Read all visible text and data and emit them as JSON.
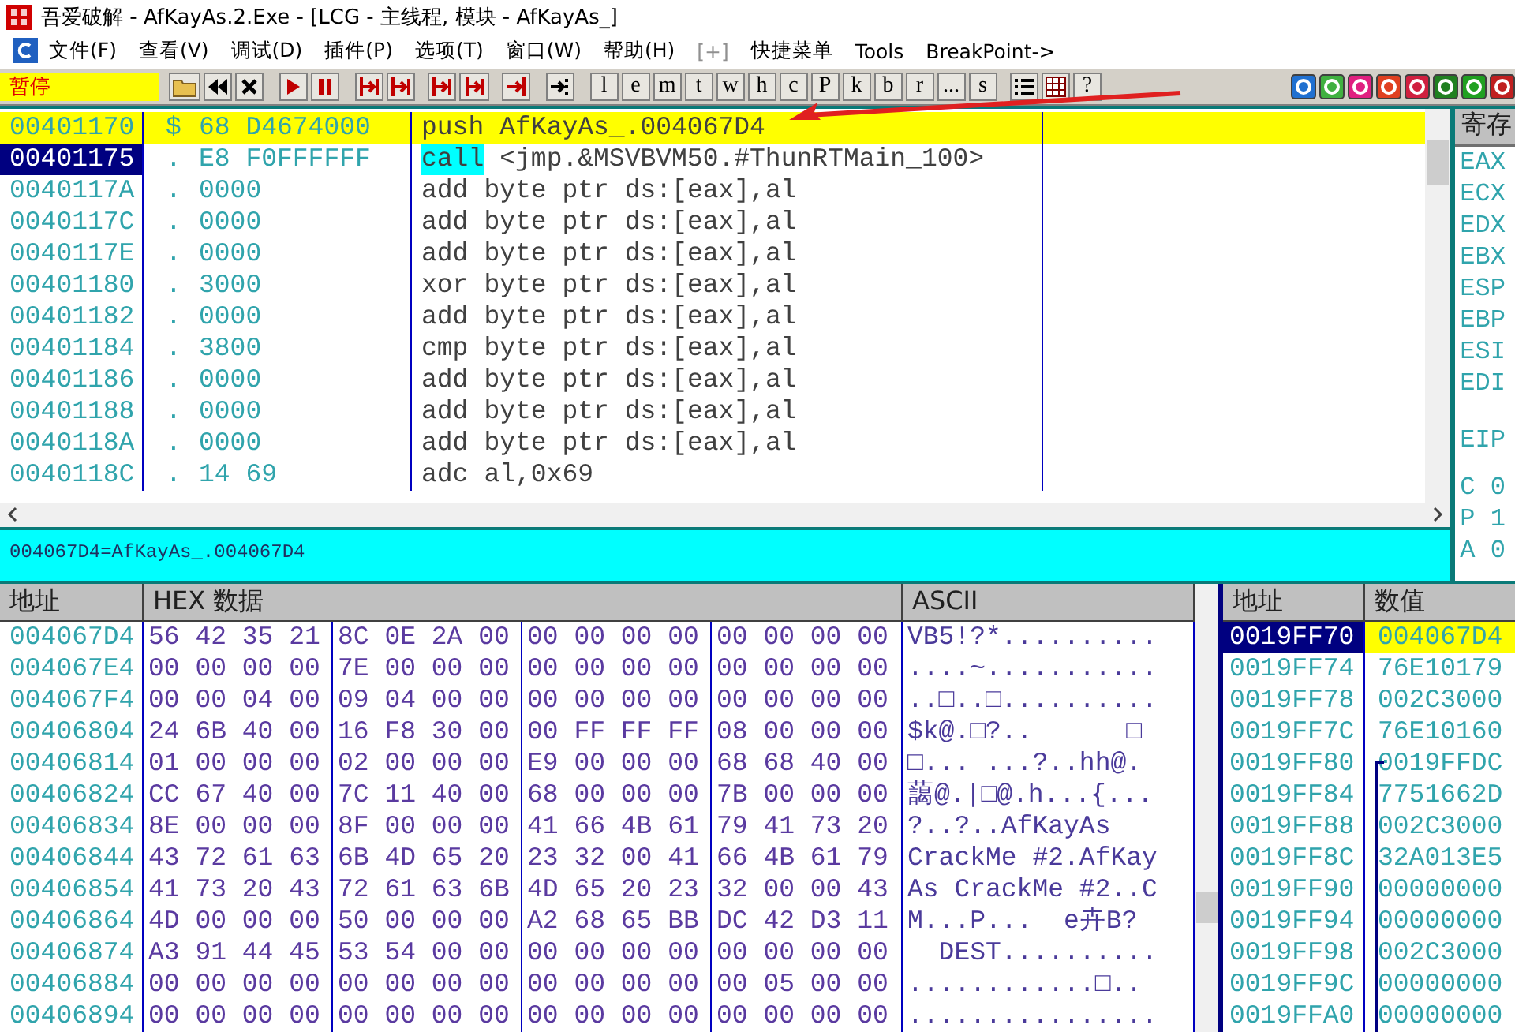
{
  "window": {
    "title": "吾爱破解 - AfKayAs.2.Exe - [LCG -  主线程, 模块 - AfKayAs_]"
  },
  "menu": [
    {
      "label": "文件(F)",
      "disabled": false
    },
    {
      "label": "查看(V)",
      "disabled": false
    },
    {
      "label": "调试(D)",
      "disabled": false
    },
    {
      "label": "插件(P)",
      "disabled": false
    },
    {
      "label": "选项(T)",
      "disabled": false
    },
    {
      "label": "窗口(W)",
      "disabled": false
    },
    {
      "label": "帮助(H)",
      "disabled": false
    },
    {
      "label": "[+]",
      "disabled": true
    },
    {
      "label": "快捷菜单",
      "disabled": false
    },
    {
      "label": "Tools",
      "disabled": false
    },
    {
      "label": "BreakPoint->",
      "disabled": false
    }
  ],
  "toolbar": {
    "status": "暂停",
    "letter_buttons": [
      "l",
      "e",
      "m",
      "t",
      "w",
      "h",
      "c",
      "P",
      "k",
      "b",
      "r",
      "...",
      "s"
    ],
    "help_button": "?"
  },
  "disassembly": {
    "rows": [
      {
        "address": "00401170",
        "marker": "$",
        "hex": "68 D4674000",
        "mnemonic": "push",
        "operands": "AfKayAs_.004067D4",
        "current": true,
        "selected": false,
        "mnemonic_highlight": false
      },
      {
        "address": "00401175",
        "marker": ".",
        "hex": "E8 F0FFFFFF",
        "mnemonic": "call",
        "operands": "<jmp.&MSVBVM50.#ThunRTMain_100>",
        "current": false,
        "selected": true,
        "mnemonic_highlight": true
      },
      {
        "address": "0040117A",
        "marker": ".",
        "hex": "0000",
        "mnemonic": "add",
        "operands": "byte ptr ds:[eax],al",
        "current": false,
        "selected": false,
        "mnemonic_highlight": false
      },
      {
        "address": "0040117C",
        "marker": ".",
        "hex": "0000",
        "mnemonic": "add",
        "operands": "byte ptr ds:[eax],al",
        "current": false,
        "selected": false,
        "mnemonic_highlight": false
      },
      {
        "address": "0040117E",
        "marker": ".",
        "hex": "0000",
        "mnemonic": "add",
        "operands": "byte ptr ds:[eax],al",
        "current": false,
        "selected": false,
        "mnemonic_highlight": false
      },
      {
        "address": "00401180",
        "marker": ".",
        "hex": "3000",
        "mnemonic": "xor",
        "operands": "byte ptr ds:[eax],al",
        "current": false,
        "selected": false,
        "mnemonic_highlight": false
      },
      {
        "address": "00401182",
        "marker": ".",
        "hex": "0000",
        "mnemonic": "add",
        "operands": "byte ptr ds:[eax],al",
        "current": false,
        "selected": false,
        "mnemonic_highlight": false
      },
      {
        "address": "00401184",
        "marker": ".",
        "hex": "3800",
        "mnemonic": "cmp",
        "operands": "byte ptr ds:[eax],al",
        "current": false,
        "selected": false,
        "mnemonic_highlight": false
      },
      {
        "address": "00401186",
        "marker": ".",
        "hex": "0000",
        "mnemonic": "add",
        "operands": "byte ptr ds:[eax],al",
        "current": false,
        "selected": false,
        "mnemonic_highlight": false
      },
      {
        "address": "00401188",
        "marker": ".",
        "hex": "0000",
        "mnemonic": "add",
        "operands": "byte ptr ds:[eax],al",
        "current": false,
        "selected": false,
        "mnemonic_highlight": false
      },
      {
        "address": "0040118A",
        "marker": ".",
        "hex": "0000",
        "mnemonic": "add",
        "operands": "byte ptr ds:[eax],al",
        "current": false,
        "selected": false,
        "mnemonic_highlight": false
      },
      {
        "address": "0040118C",
        "marker": ".",
        "hex": "14 69",
        "mnemonic": "adc",
        "operands": "al,0x69",
        "current": false,
        "selected": false,
        "mnemonic_highlight": false
      }
    ]
  },
  "info_line": "004067D4=AfKayAs_.004067D4",
  "registers": {
    "header": "寄存",
    "names": [
      "EAX",
      "ECX",
      "EDX",
      "EBX",
      "ESP",
      "EBP",
      "ESI",
      "EDI"
    ],
    "eip": "EIP",
    "flags": [
      "C 0",
      "P 1",
      "A 0"
    ]
  },
  "dump": {
    "columns": [
      "地址",
      "HEX 数据",
      "ASCII"
    ],
    "rows": [
      {
        "address": "004067D4",
        "hex": [
          "56 42 35 21",
          "8C 0E 2A 00",
          "00 00 00 00",
          "00 00 00 00"
        ],
        "ascii": "VB5!?*.........."
      },
      {
        "address": "004067E4",
        "hex": [
          "00 00 00 00",
          "7E 00 00 00",
          "00 00 00 00",
          "00 00 00 00"
        ],
        "ascii": "....~..........."
      },
      {
        "address": "004067F4",
        "hex": [
          "00 00 04 00",
          "09 04 00 00",
          "00 00 00 00",
          "00 00 00 00"
        ],
        "ascii": "..□..□.........."
      },
      {
        "address": "00406804",
        "hex": [
          "24 6B 40 00",
          "16 F8 30 00",
          "00 FF FF FF",
          "08 00 00 00"
        ],
        "ascii": "$k@.□?..      □"
      },
      {
        "address": "00406814",
        "hex": [
          "01 00 00 00",
          "02 00 00 00",
          "E9 00 00 00",
          "68 68 40 00"
        ],
        "ascii": "□... ...?..hh@."
      },
      {
        "address": "00406824",
        "hex": [
          "CC 67 40 00",
          "7C 11 40 00",
          "68 00 00 00",
          "7B 00 00 00"
        ],
        "ascii": "藹@.|□@.h...{..."
      },
      {
        "address": "00406834",
        "hex": [
          "8E 00 00 00",
          "8F 00 00 00",
          "41 66 4B 61",
          "79 41 73 20"
        ],
        "ascii": "?..?..AfKayAs"
      },
      {
        "address": "00406844",
        "hex": [
          "43 72 61 63",
          "6B 4D 65 20",
          "23 32 00 41",
          "66 4B 61 79"
        ],
        "ascii": "CrackMe #2.AfKay"
      },
      {
        "address": "00406854",
        "hex": [
          "41 73 20 43",
          "72 61 63 6B",
          "4D 65 20 23",
          "32 00 00 43"
        ],
        "ascii": "As CrackMe #2..C"
      },
      {
        "address": "00406864",
        "hex": [
          "4D 00 00 00",
          "50 00 00 00",
          "A2 68 65 BB",
          "DC 42 D3 11"
        ],
        "ascii": "M...P...  e卉B?"
      },
      {
        "address": "00406874",
        "hex": [
          "A3 91 44 45",
          "53 54 00 00",
          "00 00 00 00",
          "00 00 00 00"
        ],
        "ascii": "  DEST.........."
      },
      {
        "address": "00406884",
        "hex": [
          "00 00 00 00",
          "00 00 00 00",
          "00 00 00 00",
          "00 05 00 00"
        ],
        "ascii": "............□.."
      },
      {
        "address": "00406894",
        "hex": [
          "00 00 00 00",
          "00 00 00 00",
          "00 00 00 00",
          "00 00 00 00"
        ],
        "ascii": "................"
      }
    ]
  },
  "stack": {
    "columns": [
      "地址",
      "数值"
    ],
    "rows": [
      {
        "address": "0019FF70",
        "value": "004067D4",
        "selected": true
      },
      {
        "address": "0019FF74",
        "value": "76E10179",
        "selected": false
      },
      {
        "address": "0019FF78",
        "value": "002C3000",
        "selected": false
      },
      {
        "address": "0019FF7C",
        "value": "76E10160",
        "selected": false
      },
      {
        "address": "0019FF80",
        "value": "0019FFDC",
        "selected": false
      },
      {
        "address": "0019FF84",
        "value": "7751662D",
        "selected": false
      },
      {
        "address": "0019FF88",
        "value": "002C3000",
        "selected": false
      },
      {
        "address": "0019FF8C",
        "value": "32A013E5",
        "selected": false
      },
      {
        "address": "0019FF90",
        "value": "00000000",
        "selected": false
      },
      {
        "address": "0019FF94",
        "value": "00000000",
        "selected": false
      },
      {
        "address": "0019FF98",
        "value": "002C3000",
        "selected": false
      },
      {
        "address": "0019FF9C",
        "value": "00000000",
        "selected": false
      },
      {
        "address": "0019FFA0",
        "value": "00000000",
        "selected": false
      }
    ]
  }
}
